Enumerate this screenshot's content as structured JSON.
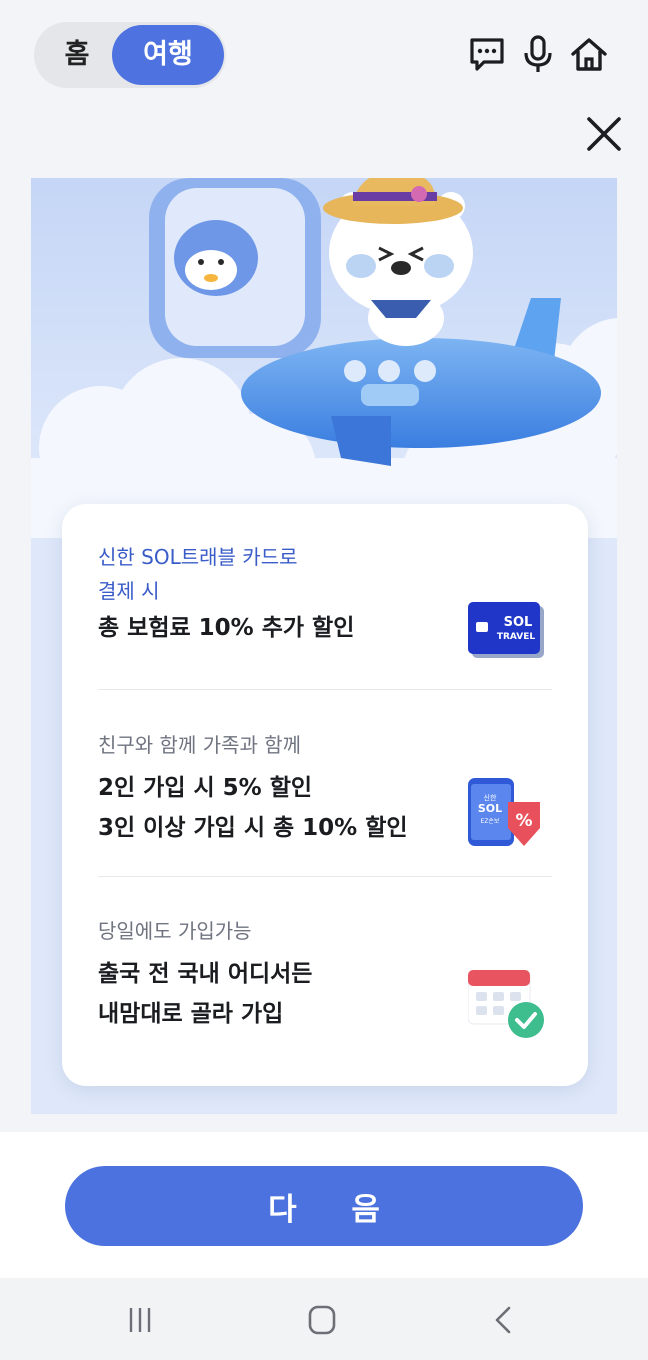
{
  "header": {
    "toggle_home": "홈",
    "toggle_travel": "여행",
    "icons": [
      "chat-icon",
      "microphone-icon",
      "home-icon"
    ]
  },
  "close_icon": "close-icon",
  "benefits": [
    {
      "subtitle_line1": "신한 SOL트래블 카드로",
      "subtitle_line2": "결제 시",
      "title_line1": "총 보험료 10% 추가 할인",
      "badge_line1": "SOL",
      "badge_line2": "TRAVEL"
    },
    {
      "subtitle_line1": "친구와 함께 가족과 함께",
      "title_line1": "2인 가입 시 5% 할인",
      "title_line2": "3인 이상 가입 시 총 10% 할인",
      "phone_line1": "신한",
      "phone_line2": "SOL",
      "phone_line3": "EZ손보",
      "coupon": "%"
    },
    {
      "subtitle_line1": "당일에도 가입가능",
      "title_line1": "출국 전 국내 어디서든",
      "title_line2": "내맘대로 골라 가입"
    }
  ],
  "next_button": "다 음",
  "colors": {
    "accent": "#4c72e0",
    "subtitle_blue": "#3a5cc8",
    "subtitle_grey": "#6f7480"
  }
}
